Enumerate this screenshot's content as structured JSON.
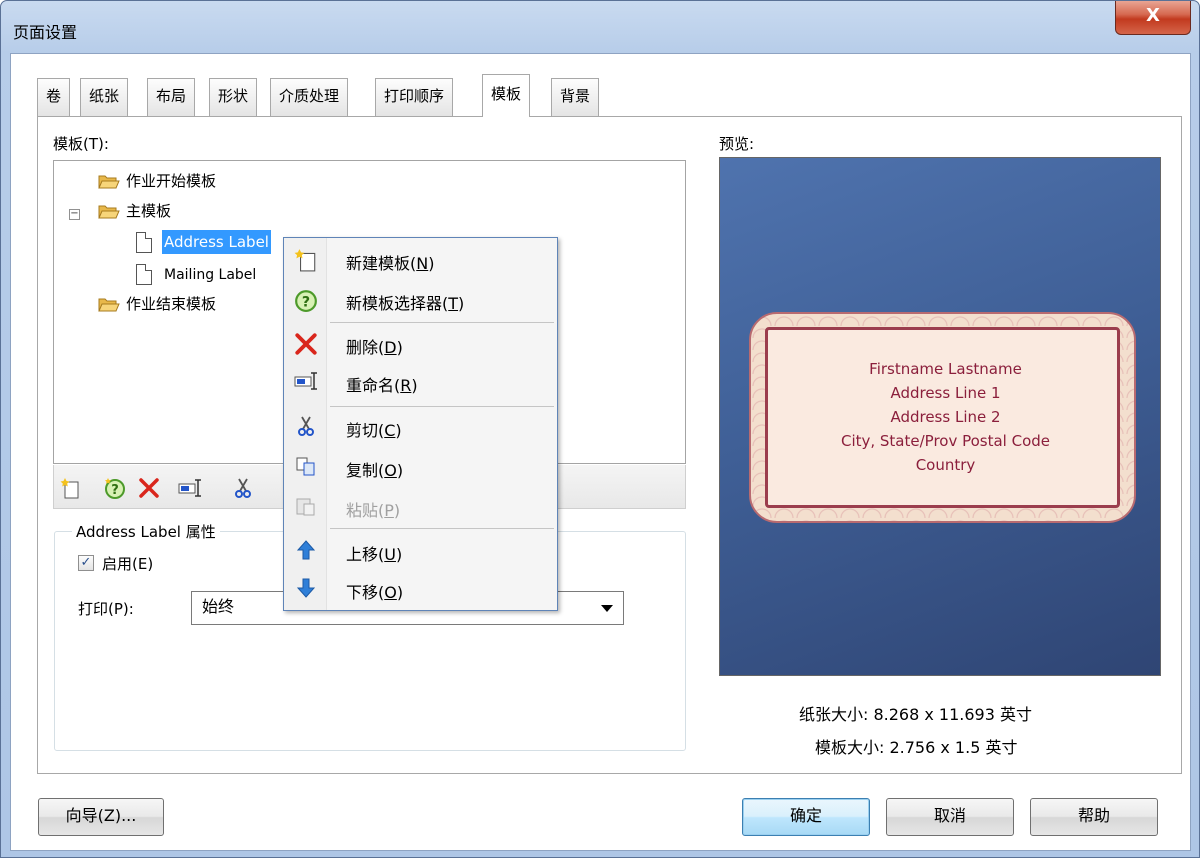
{
  "window": {
    "title": "页面设置",
    "close_glyph": "X"
  },
  "tabs": [
    {
      "label": "卷",
      "active": false
    },
    {
      "label": "纸张",
      "active": false
    },
    {
      "label": "布局",
      "active": false
    },
    {
      "label": "形状",
      "active": false
    },
    {
      "label": "介质处理",
      "active": false
    },
    {
      "label": "打印顺序",
      "active": false
    },
    {
      "label": "模板",
      "active": true
    },
    {
      "label": "背景",
      "active": false
    }
  ],
  "templates": {
    "label": "模板(T):",
    "tree": {
      "job_start": "作业开始模板",
      "master": "主模板",
      "master_expander": "⊟",
      "address_label": "Address Label",
      "mailing_label": "Mailing Label",
      "job_end": "作业结束模板"
    }
  },
  "toolbar": {
    "icons": [
      "new-template-icon",
      "template-wizard-icon",
      "delete-icon",
      "rename-icon",
      "cut-icon"
    ]
  },
  "properties": {
    "legend": "Address Label 属性",
    "enable_label": "启用(E)",
    "enable_checked": true,
    "print_label": "打印(P):",
    "print_value": "始终"
  },
  "preview": {
    "label": "预览:",
    "address_lines": [
      "Firstname Lastname",
      "Address Line 1",
      "Address Line 2",
      "City, State/Prov  Postal Code",
      "Country"
    ],
    "paper_size": "纸张大小: 8.268 x 11.693 英寸",
    "template_size": "模板大小: 2.756 x 1.5 英寸"
  },
  "buttons": {
    "wizard": "向导(Z)...",
    "ok": "确定",
    "cancel": "取消",
    "help": "帮助"
  },
  "context_menu": {
    "new_template": {
      "text": "新建模板(",
      "key": "N",
      "tail": ")"
    },
    "template_wizard": {
      "text": "新模板选择器(",
      "key": "T",
      "tail": ")"
    },
    "delete": {
      "text": "删除(",
      "key": "D",
      "tail": ")"
    },
    "rename": {
      "text": "重命名(",
      "key": "R",
      "tail": ")"
    },
    "cut": {
      "text": "剪切(",
      "key": "C",
      "tail": ")"
    },
    "copy": {
      "text": "复制(",
      "key": "O",
      "tail": ")"
    },
    "paste": {
      "text": "粘贴(",
      "key": "P",
      "tail": ")"
    },
    "move_up": {
      "text": "上移(",
      "key": "U",
      "tail": ")"
    },
    "move_down": {
      "text": "下移(",
      "key": "O",
      "tail": ")"
    }
  },
  "colors": {
    "selection": "#3399ff",
    "address_text": "#8b1f3c",
    "preview_bg": "#3f5f96",
    "delete_red": "#d9261c",
    "move_blue": "#2f7fd8"
  }
}
